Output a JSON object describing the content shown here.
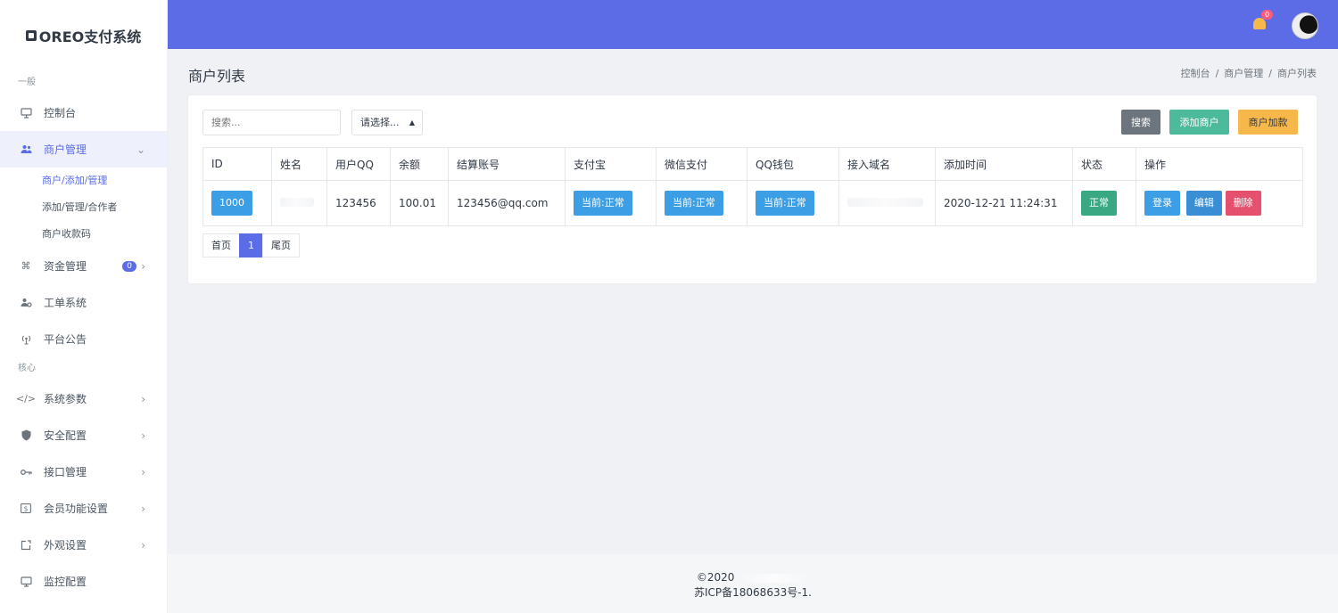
{
  "app": {
    "logo": "OREO支付系统"
  },
  "sidebar": {
    "section1": "一般",
    "section2": "核心",
    "items": [
      {
        "label": "控制台",
        "icon": "monitor-icon"
      },
      {
        "label": "商户管理",
        "icon": "users-icon"
      },
      {
        "label": "资金管理",
        "icon": "command-icon",
        "badge": "0"
      },
      {
        "label": "工单系统",
        "icon": "user-gear-icon"
      },
      {
        "label": "平台公告",
        "icon": "broadcast-icon"
      },
      {
        "label": "系统参数",
        "icon": "code-icon"
      },
      {
        "label": "安全配置",
        "icon": "shield-icon"
      },
      {
        "label": "接口管理",
        "icon": "key-icon"
      },
      {
        "label": "会员功能设置",
        "icon": "dollar-box-icon"
      },
      {
        "label": "外观设置",
        "icon": "edit-box-icon"
      },
      {
        "label": "监控配置",
        "icon": "display-icon"
      }
    ],
    "sub_items": [
      "商户/添加/管理",
      "添加/管理/合作者",
      "商户收款码"
    ]
  },
  "topbar": {
    "notification_count": "0"
  },
  "page": {
    "title": "商户列表",
    "breadcrumb": [
      "控制台",
      "商户管理",
      "商户列表"
    ]
  },
  "toolbar": {
    "search_placeholder": "搜索...",
    "select_value": "请选择...",
    "search_button": "搜索",
    "add_button": "添加商户",
    "fund_button": "商户加款"
  },
  "table": {
    "headers": [
      "ID",
      "姓名",
      "用户QQ",
      "余额",
      "结算账号",
      "支付宝",
      "微信支付",
      "QQ钱包",
      "接入域名",
      "添加时间",
      "状态",
      "操作"
    ],
    "rows": [
      {
        "id": "1000",
        "name": "",
        "qq": "123456",
        "balance": "100.01",
        "account": "123456@qq.com",
        "alipay": "当前:正常",
        "wechat": "当前:正常",
        "qqwallet": "当前:正常",
        "domain": "",
        "added": "2020-12-21 11:24:31",
        "status": "正常",
        "actions": {
          "login": "登录",
          "edit": "编辑",
          "delete": "删除"
        }
      }
    ]
  },
  "pager": {
    "first": "首页",
    "current": "1",
    "last": "尾页"
  },
  "footer": {
    "line1": "©2020",
    "line2": "苏ICP备18068633号-1."
  },
  "colors": {
    "primary": "#5b6ce6",
    "info": "#3c9ee5",
    "success": "#3aa883",
    "danger": "#e4506e",
    "warning": "#f7b84b",
    "secondary": "#6c757d"
  }
}
